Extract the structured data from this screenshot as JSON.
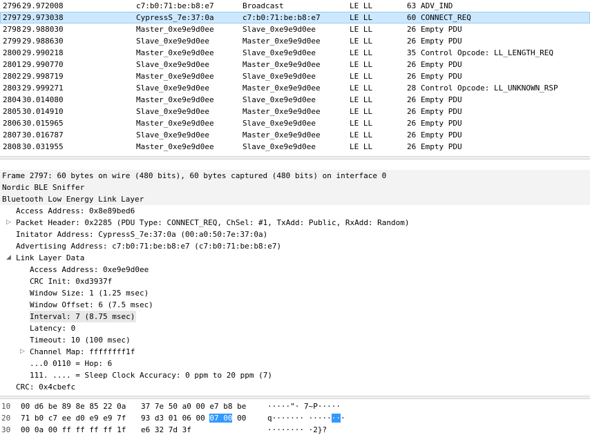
{
  "packet_list": {
    "rows": [
      {
        "no": "2796",
        "time": "29.972008",
        "source": "c7:b0:71:be:b8:e7",
        "destination": "Broadcast",
        "protocol": "LE LL",
        "length": "63",
        "info": "ADV_IND",
        "selected": false
      },
      {
        "no": "2797",
        "time": "29.973038",
        "source": "CypressS_7e:37:0a",
        "destination": "c7:b0:71:be:b8:e7",
        "protocol": "LE LL",
        "length": "60",
        "info": "CONNECT_REQ",
        "selected": true
      },
      {
        "no": "2798",
        "time": "29.988030",
        "source": "Master_0xe9e9d0ee",
        "destination": "Slave_0xe9e9d0ee",
        "protocol": "LE LL",
        "length": "26",
        "info": "Empty PDU",
        "selected": false
      },
      {
        "no": "2799",
        "time": "29.988630",
        "source": "Slave_0xe9e9d0ee",
        "destination": "Master_0xe9e9d0ee",
        "protocol": "LE LL",
        "length": "26",
        "info": "Empty PDU",
        "selected": false
      },
      {
        "no": "2800",
        "time": "29.990218",
        "source": "Master_0xe9e9d0ee",
        "destination": "Slave_0xe9e9d0ee",
        "protocol": "LE LL",
        "length": "35",
        "info": "Control Opcode: LL_LENGTH_REQ",
        "selected": false
      },
      {
        "no": "2801",
        "time": "29.990770",
        "source": "Slave_0xe9e9d0ee",
        "destination": "Master_0xe9e9d0ee",
        "protocol": "LE LL",
        "length": "26",
        "info": "Empty PDU",
        "selected": false
      },
      {
        "no": "2802",
        "time": "29.998719",
        "source": "Master_0xe9e9d0ee",
        "destination": "Slave_0xe9e9d0ee",
        "protocol": "LE LL",
        "length": "26",
        "info": "Empty PDU",
        "selected": false
      },
      {
        "no": "2803",
        "time": "29.999271",
        "source": "Slave_0xe9e9d0ee",
        "destination": "Master_0xe9e9d0ee",
        "protocol": "LE LL",
        "length": "28",
        "info": "Control Opcode: LL_UNKNOWN_RSP",
        "selected": false
      },
      {
        "no": "2804",
        "time": "30.014080",
        "source": "Master_0xe9e9d0ee",
        "destination": "Slave_0xe9e9d0ee",
        "protocol": "LE LL",
        "length": "26",
        "info": "Empty PDU",
        "selected": false
      },
      {
        "no": "2805",
        "time": "30.014910",
        "source": "Slave_0xe9e9d0ee",
        "destination": "Master_0xe9e9d0ee",
        "protocol": "LE LL",
        "length": "26",
        "info": "Empty PDU",
        "selected": false
      },
      {
        "no": "2806",
        "time": "30.015965",
        "source": "Master_0xe9e9d0ee",
        "destination": "Slave_0xe9e9d0ee",
        "protocol": "LE LL",
        "length": "26",
        "info": "Empty PDU",
        "selected": false
      },
      {
        "no": "2807",
        "time": "30.016787",
        "source": "Slave_0xe9e9d0ee",
        "destination": "Master_0xe9e9d0ee",
        "protocol": "LE LL",
        "length": "26",
        "info": "Empty PDU",
        "selected": false
      },
      {
        "no": "2808",
        "time": "30.031955",
        "source": "Master_0xe9e9d0ee",
        "destination": "Slave_0xe9e9d0ee",
        "protocol": "LE LL",
        "length": "26",
        "info": "Empty PDU",
        "selected": false
      }
    ]
  },
  "details": {
    "lines": [
      {
        "text": "Frame 2797: 60 bytes on wire (480 bits), 60 bytes captured (480 bits) on interface 0",
        "toggle": "none",
        "style": "bg"
      },
      {
        "text": "Nordic BLE Sniffer",
        "toggle": "none",
        "style": "bg"
      },
      {
        "text": "Bluetooth Low Energy Link Layer",
        "toggle": "none",
        "style": "bg"
      },
      {
        "text": "Access Address: 0x8e89bed6",
        "toggle": "none",
        "style": ""
      },
      {
        "text": "Packet Header: 0x2285 (PDU Type: CONNECT_REQ, ChSel: #1, TxAdd: Public, RxAdd: Random)",
        "toggle": "collapsed",
        "style": ""
      },
      {
        "text": "Initator Address: CypressS_7e:37:0a (00:a0:50:7e:37:0a)",
        "toggle": "none",
        "style": ""
      },
      {
        "text": "Advertising Address: c7:b0:71:be:b8:e7 (c7:b0:71:be:b8:e7)",
        "toggle": "none",
        "style": ""
      },
      {
        "text": "Link Layer Data",
        "toggle": "expanded",
        "style": ""
      },
      {
        "text": "Access Address: 0xe9e9d0ee",
        "toggle": "none",
        "style": ""
      },
      {
        "text": "CRC Init: 0xd3937f",
        "toggle": "none",
        "style": ""
      },
      {
        "text": "Window Size: 1 (1.25 msec)",
        "toggle": "none",
        "style": ""
      },
      {
        "text": "Window Offset: 6 (7.5 msec)",
        "toggle": "none",
        "style": ""
      },
      {
        "text": "Interval: 7 (8.75 msec)",
        "toggle": "none",
        "style": "hl"
      },
      {
        "text": "Latency: 0",
        "toggle": "none",
        "style": ""
      },
      {
        "text": "Timeout: 10 (100 msec)",
        "toggle": "none",
        "style": ""
      },
      {
        "text": "Channel Map: ffffffff1f",
        "toggle": "collapsed",
        "style": ""
      },
      {
        "text": "...0 0110 = Hop: 6",
        "toggle": "none",
        "style": ""
      },
      {
        "text": "111. .... = Sleep Clock Accuracy: 0 ppm to 20 ppm (7)",
        "toggle": "none",
        "style": ""
      },
      {
        "text": "CRC: 0x4cbefc",
        "toggle": "none",
        "style": ""
      }
    ]
  },
  "hex": {
    "rows": [
      {
        "offset": "10",
        "bytes1": "00 d6 be 89 8e 85 22 0a",
        "bytes2_pre": "37 7e 50 a0 00 e7 b8 be",
        "bytes2_sel": "",
        "bytes2_post": "",
        "ascii_pre": "·····\"· 7~P·····",
        "ascii_sel": "",
        "ascii_post": ""
      },
      {
        "offset": "20",
        "bytes1": "71 b0 c7 ee d0 e9 e9 7f",
        "bytes2_pre": "93 d3 01 06 00 ",
        "bytes2_sel": "07 00",
        "bytes2_post": " 00",
        "ascii_pre": "q······· ·····",
        "ascii_sel": "··",
        "ascii_post": "·"
      },
      {
        "offset": "30",
        "bytes1": "00 0a 00 ff ff ff ff 1f",
        "bytes2_pre": "e6 32 7d 3f",
        "bytes2_sel": "",
        "bytes2_post": "",
        "ascii_pre": "········ ·2}?",
        "ascii_sel": "",
        "ascii_post": ""
      }
    ]
  }
}
